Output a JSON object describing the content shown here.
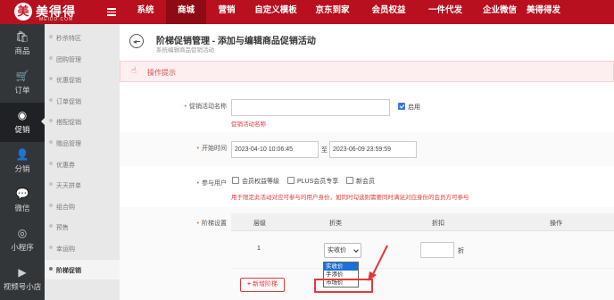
{
  "brand": {
    "name": "美得得",
    "sub": "MEIDD.COM",
    "mark": "美"
  },
  "colors": {
    "brand": "#b8101f",
    "accent": "#e4393c",
    "link": "#1e6fd9"
  },
  "topnav": [
    {
      "label": "系统"
    },
    {
      "label": "商城",
      "active": true
    },
    {
      "label": "营销"
    },
    {
      "label": "自定义模板"
    },
    {
      "label": "京东到家"
    },
    {
      "label": "会员权益"
    },
    {
      "label": "一件代发"
    },
    {
      "label": "企业微信"
    },
    {
      "label": "美得得发"
    }
  ],
  "leftnav": [
    {
      "label": "商品",
      "icon": "bag-icon"
    },
    {
      "label": "订单",
      "icon": "cart-icon"
    },
    {
      "label": "促销",
      "icon": "sale-icon",
      "active": true
    },
    {
      "label": "分销",
      "icon": "user-icon"
    },
    {
      "label": "微信",
      "icon": "wechat-icon"
    },
    {
      "label": "小程序",
      "icon": "miniapp-icon"
    },
    {
      "label": "视频号小店",
      "icon": "video-icon"
    }
  ],
  "subnav": [
    {
      "label": "秒杀特区"
    },
    {
      "label": "团购管理"
    },
    {
      "label": "优惠促销"
    },
    {
      "label": "订单促销"
    },
    {
      "label": "搭配促销"
    },
    {
      "label": "赠品管理"
    },
    {
      "label": "优惠券"
    },
    {
      "label": "天天拼单"
    },
    {
      "label": "组合购"
    },
    {
      "label": "预售"
    },
    {
      "label": "幸运购"
    },
    {
      "label": "阶梯促销",
      "active": true
    }
  ],
  "page": {
    "title": "阶梯促销管理 - 添加与编辑商品促销活动",
    "subtitle": "系统编辑商品促销活动",
    "tips_label": "操作提示"
  },
  "form": {
    "name": {
      "label": "促销活动名称",
      "value": "",
      "enable_label": "启用",
      "enabled": true,
      "hint": "促销活动名称"
    },
    "time": {
      "label": "开始时间",
      "start": "2023-04-10 10:06:45",
      "sep": "至",
      "end": "2023-06-09 23:59:59"
    },
    "users": {
      "label": "参与用户",
      "options": [
        {
          "label": "会员权益等级"
        },
        {
          "label": "PLUS会员专享"
        },
        {
          "label": "新会员"
        }
      ],
      "hint": "用于限定此活动对应可参与的用户身份，如同时勾选则需要同时满足对应身份的会员方可参与"
    },
    "tiers": {
      "label": "阶梯设置",
      "headers": [
        "层级",
        "折类",
        "折扣",
        "操作"
      ],
      "rows": [
        {
          "level": "1",
          "type": "实收价",
          "discount": "",
          "unit": "折"
        }
      ],
      "dropdown_options": [
        {
          "label": "实收价",
          "selected": true
        },
        {
          "label": "手添价"
        },
        {
          "label": "市场价",
          "highlighted": true
        }
      ],
      "add_label": "新增阶梯"
    }
  }
}
